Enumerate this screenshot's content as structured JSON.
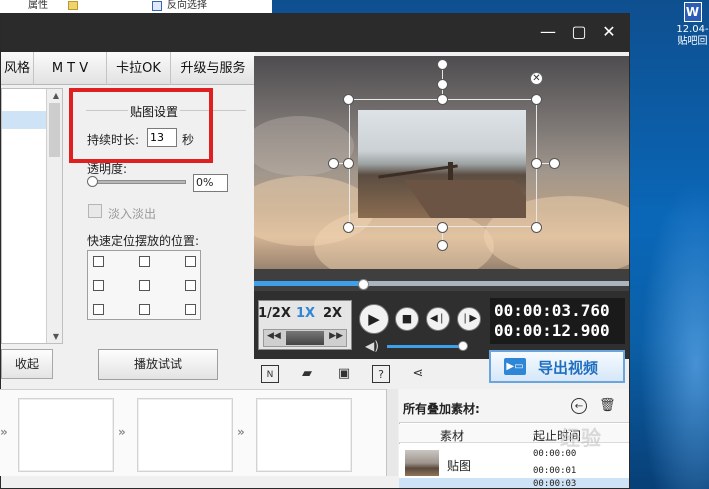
{
  "desktop": {
    "explorer_item_1": "属性",
    "explorer_item_2": "反向选择",
    "icon_label_1": "12.04-",
    "icon_label_2": "贴吧回",
    "icon_glyph": "W"
  },
  "window": {
    "min_icon": "—",
    "max_icon": "▢",
    "close_icon": "✕"
  },
  "tabs": [
    {
      "label": "风格"
    },
    {
      "label": "M T V"
    },
    {
      "label": "卡拉OK"
    },
    {
      "label": "升级与服务"
    }
  ],
  "left": {
    "collapse_label": "收起"
  },
  "sticker_settings": {
    "group_title": "贴图设置",
    "duration_label": "持续时长:",
    "duration_value": "13",
    "duration_unit": "秒",
    "opacity_label": "透明度:",
    "opacity_value": "0%",
    "opacity_level": 0,
    "fade_label": "淡入淡出",
    "fade_checked": false,
    "position_label": "快速定位摆放的位置:",
    "try_button": "播放试试"
  },
  "player": {
    "speed_options": [
      "1/2X",
      "1X",
      "2X"
    ],
    "speed_selected": "1X",
    "current_time": "00:00:03.760",
    "total_time": "00:00:12.900",
    "progress_fraction": 0.29,
    "volume_fraction": 1.0,
    "export_label": "导出视频"
  },
  "materials": {
    "title": "所有叠加素材:",
    "col_material": "素材",
    "col_time": "起止时间",
    "rows": [
      {
        "name": "贴图",
        "start": "00:00:00",
        "end": "00:00:01"
      }
    ],
    "row2_start": "00:00:03"
  },
  "watermark": "经验",
  "colors": {
    "accent": "#2f86d6",
    "highlight_box": "#e02020",
    "titlebar": "#2b2b2b"
  }
}
